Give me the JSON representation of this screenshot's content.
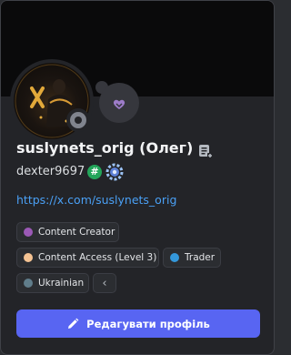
{
  "profile": {
    "display_name": "suslynets_orig (Олег)",
    "username": "dexter9697",
    "hash_badge": "#",
    "link": "https://x.com/suslynets_orig"
  },
  "roles": [
    {
      "label": "Content Creator",
      "color": "#9b59b6"
    },
    {
      "label": "Content Access (Level 3)",
      "color": "#f5c393"
    },
    {
      "label": "Trader",
      "color": "#3498db"
    },
    {
      "label": "Ukrainian",
      "color": "#607d8b"
    }
  ],
  "roles_more": "‹",
  "actions": {
    "edit_profile": "Редагувати профіль"
  },
  "colors": {
    "accent": "#5865f2",
    "link": "#4aa0f5",
    "banner": "#0a0a0b",
    "status_offline": "#80848e"
  },
  "icons": {
    "status": "offline-status-icon",
    "activity": "activity-bubble-icon",
    "note": "add-note-icon",
    "nitro": "nitro-gear-badge-icon",
    "edit": "pencil-icon"
  }
}
